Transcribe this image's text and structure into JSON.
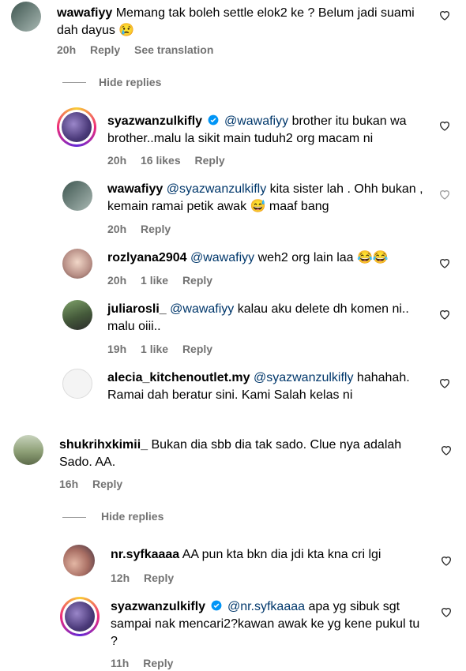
{
  "comments": [
    {
      "username": "wawafiyy",
      "text": "Memang tak boleh settle elok2 ke ? Belum jadi suami dah dayus",
      "emoji": "😢",
      "time": "20h",
      "reply_label": "Reply",
      "see_translation": "See translation"
    },
    {
      "username": "shukrihxkimii_",
      "text": "Bukan dia sbb dia tak sado. Clue nya adalah Sado. AA.",
      "time": "16h",
      "reply_label": "Reply"
    }
  ],
  "hide_replies": "Hide replies",
  "replies_a": [
    {
      "username": "syazwanzulkifly",
      "mention": "@wawafiyy",
      "text": "brother itu bukan wa brother..malu la sikit main tuduh2 org macam ni",
      "time": "20h",
      "likes": "16 likes",
      "reply_label": "Reply"
    },
    {
      "username": "wawafiyy",
      "mention": "@syazwanzulkifly",
      "text": "kita sister lah . Ohh bukan , kemain ramai petik awak",
      "emoji": "😅",
      "text2": "maaf bang",
      "time": "20h",
      "reply_label": "Reply"
    },
    {
      "username": "rozlyana2904",
      "mention": "@wawafiyy",
      "text": "weh2 org lain laa",
      "emoji": "😂😂",
      "time": "20h",
      "likes": "1 like",
      "reply_label": "Reply"
    },
    {
      "username": "juliarosli_",
      "mention": "@wawafiyy",
      "text": "kalau aku delete dh komen ni.. malu oiii..",
      "time": "19h",
      "likes": "1 like",
      "reply_label": "Reply"
    },
    {
      "username": "alecia_kitchenoutlet.my",
      "mention": "@syazwanzulkifly",
      "text": "hahahah. Ramai dah beratur sini. Kami Salah kelas ni"
    }
  ],
  "replies_b": [
    {
      "username": "nr.syfkaaaa",
      "text": "AA pun kta bkn dia jdi kta kna cri lgi",
      "time": "12h",
      "reply_label": "Reply"
    },
    {
      "username": "syazwanzulkifly",
      "mention": "@nr.syfkaaaa",
      "text": "apa yg sibuk sgt sampai nak mencari2?kawan awak ke yg kene pukul tu ?",
      "time": "11h",
      "reply_label": "Reply"
    }
  ],
  "icons": {
    "heart": "heart-icon",
    "verified": "verified-badge-icon"
  },
  "colors": {
    "mention": "#00376b",
    "meta": "#737373",
    "verified": "#0095f6"
  }
}
